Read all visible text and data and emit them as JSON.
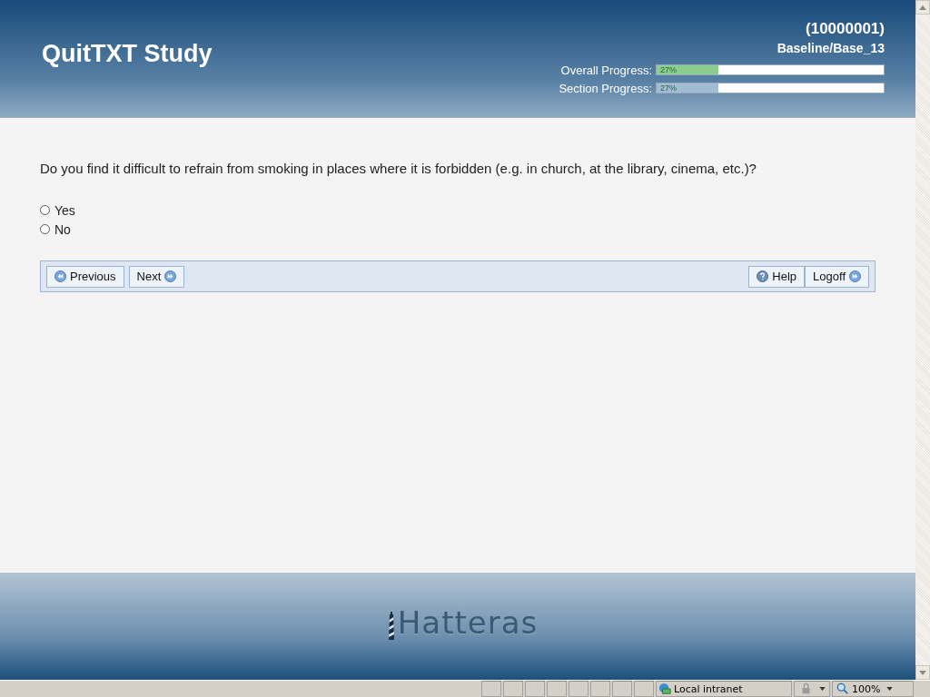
{
  "header": {
    "title": "QuitTXT Study",
    "participant_id": "(10000001)",
    "section": "Baseline/Base_13",
    "progress": [
      {
        "label": "Overall Progress:",
        "reading": "27%",
        "level": 0.27,
        "color": "#8ccc8c"
      },
      {
        "label": "Section Progress:",
        "reading": "27%",
        "level": 0.27,
        "color": "#a2bcd6"
      }
    ]
  },
  "question": {
    "text": "Do you find it difficult to refrain from smoking in places where it is forbidden (e.g. in church, at the library, cinema, etc.)?",
    "options": [
      {
        "label": "Yes",
        "selected": false
      },
      {
        "label": "No",
        "selected": false
      }
    ]
  },
  "nav_buttons": [
    {
      "label": "Previous",
      "kind": "previous"
    },
    {
      "label": "Next",
      "kind": "next"
    },
    {
      "label": "Help",
      "kind": "help"
    },
    {
      "label": "Logoff",
      "kind": "logoff"
    }
  ],
  "footer": {
    "logo": "Hatteras"
  },
  "status_bar": {
    "zone": "Local intranet",
    "zoom": "100%"
  }
}
